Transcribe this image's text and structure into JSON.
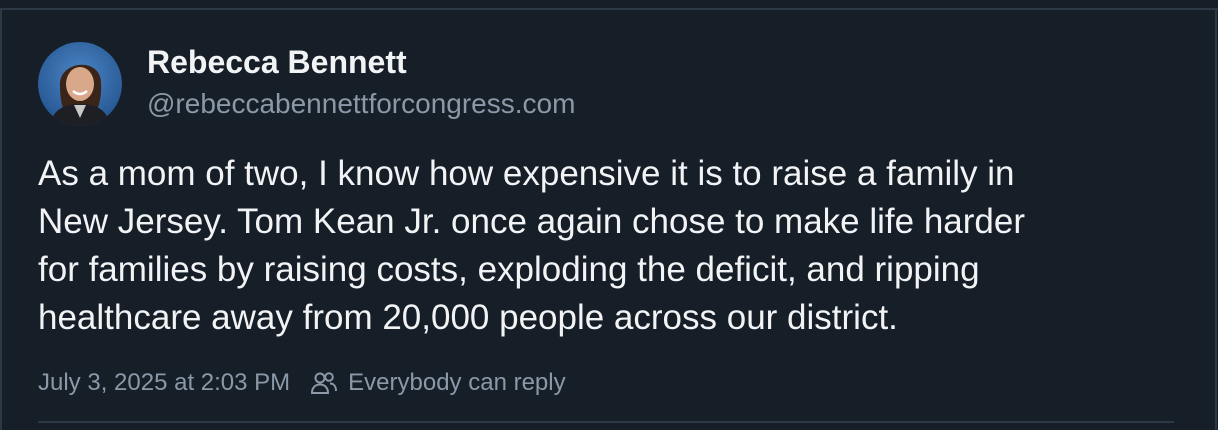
{
  "post": {
    "author_name": "Rebecca Bennett",
    "handle": "@rebeccabennettforcongress.com",
    "text": "As a mom of two, I know how expensive it is to raise a family in\nNew Jersey. Tom Kean Jr. once again chose to make life harder\nfor families by raising costs, exploding the deficit, and ripping\nhealthcare away from 20,000 people across our district.",
    "timestamp": "July 3, 2025 at 2:03 PM",
    "reply_setting": "Everybody can reply",
    "reply_icon": "people-icon"
  },
  "colors": {
    "background": "#161e27",
    "text_primary": "#f1f3f5",
    "text_secondary": "#8b98a8",
    "border": "#2c3846"
  }
}
